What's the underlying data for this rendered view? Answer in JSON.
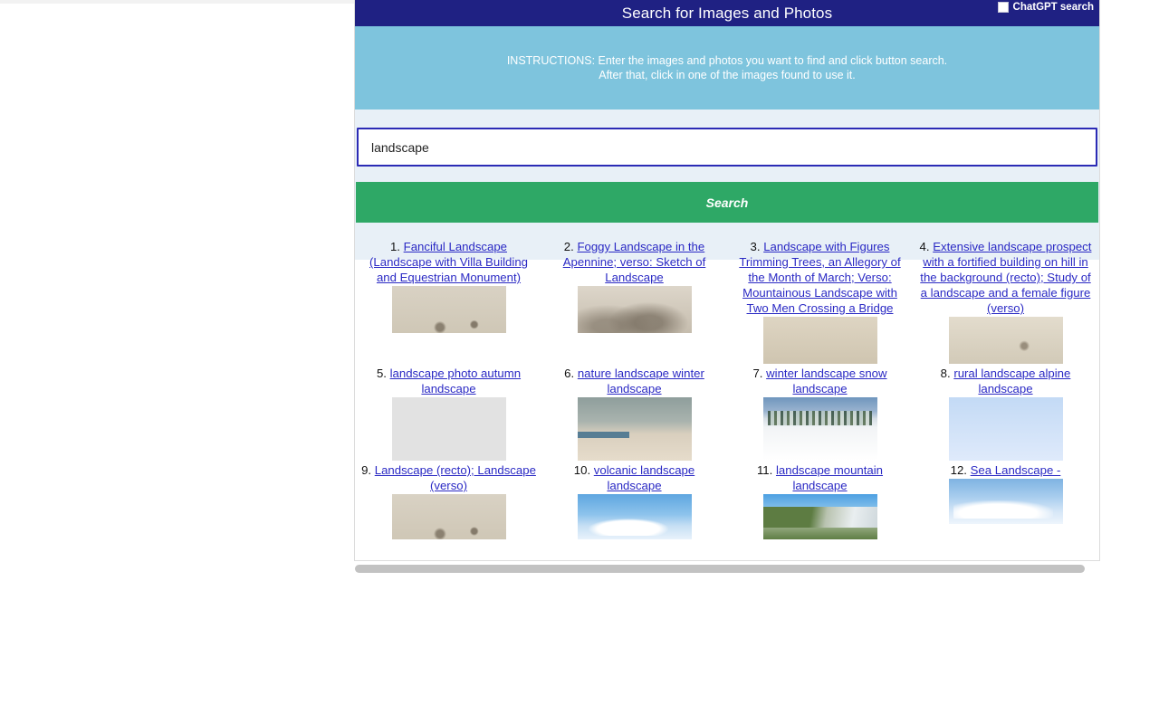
{
  "titlebar": {
    "title": "Search for Images and Photos",
    "chatgpt_checkbox_label": "ChatGPT search",
    "chatgpt_checkbox_checked": "false",
    "bg_color": "#1f2183"
  },
  "instructions": {
    "line1": "INSTRUCTIONS: Enter the images and photos you want to find and click button search.",
    "line2": "After that, click in one of the images found to use it.",
    "bg_color": "#7ec4dd"
  },
  "search": {
    "value": "landscape",
    "placeholder": "",
    "button_label": "Search",
    "button_color": "#2ea866",
    "zone_bg": "#e8f0f7",
    "input_border_color": "#2b2bb5"
  },
  "results": {
    "link_color": "#2a29c4",
    "items": [
      {
        "index": "1.",
        "title": "Fanciful Landscape (Landscape with Villa Building and Equestrian Monument)",
        "thumb_style": "th-sepia-a"
      },
      {
        "index": "2.",
        "title": "Foggy Landscape in the Apennine; verso: Sketch of Landscape",
        "thumb_style": "th-sepia-b"
      },
      {
        "index": "3.",
        "title": "Landscape with Figures Trimming Trees, an Allegory of the Month of March; Verso: Mountainous Landscape with Two Men Crossing a Bridge",
        "thumb_style": "th-sepia-c"
      },
      {
        "index": "4.",
        "title": "Extensive landscape prospect with a fortified building on hill in the background (recto); Study of a landscape and a female figure (verso)",
        "thumb_style": "th-sepia-d"
      },
      {
        "index": "5.",
        "title": "landscape photo autumn landscape",
        "thumb_style": "th-gray"
      },
      {
        "index": "6.",
        "title": "nature landscape winter landscape",
        "thumb_style": "th-dune"
      },
      {
        "index": "7.",
        "title": "winter landscape snow landscape",
        "thumb_style": "th-snow"
      },
      {
        "index": "8.",
        "title": "rural landscape alpine landscape",
        "thumb_style": "th-paleblue"
      },
      {
        "index": "9.",
        "title": "Landscape (recto); Landscape (verso)",
        "thumb_style": "th-sepia-a"
      },
      {
        "index": "10.",
        "title": "volcanic landscape landscape",
        "thumb_style": "th-sky"
      },
      {
        "index": "11.",
        "title": "landscape mountain landscape",
        "thumb_style": "th-mountain"
      },
      {
        "index": "12.",
        "title": "Sea Landscape -",
        "thumb_style": "th-sea"
      }
    ]
  }
}
